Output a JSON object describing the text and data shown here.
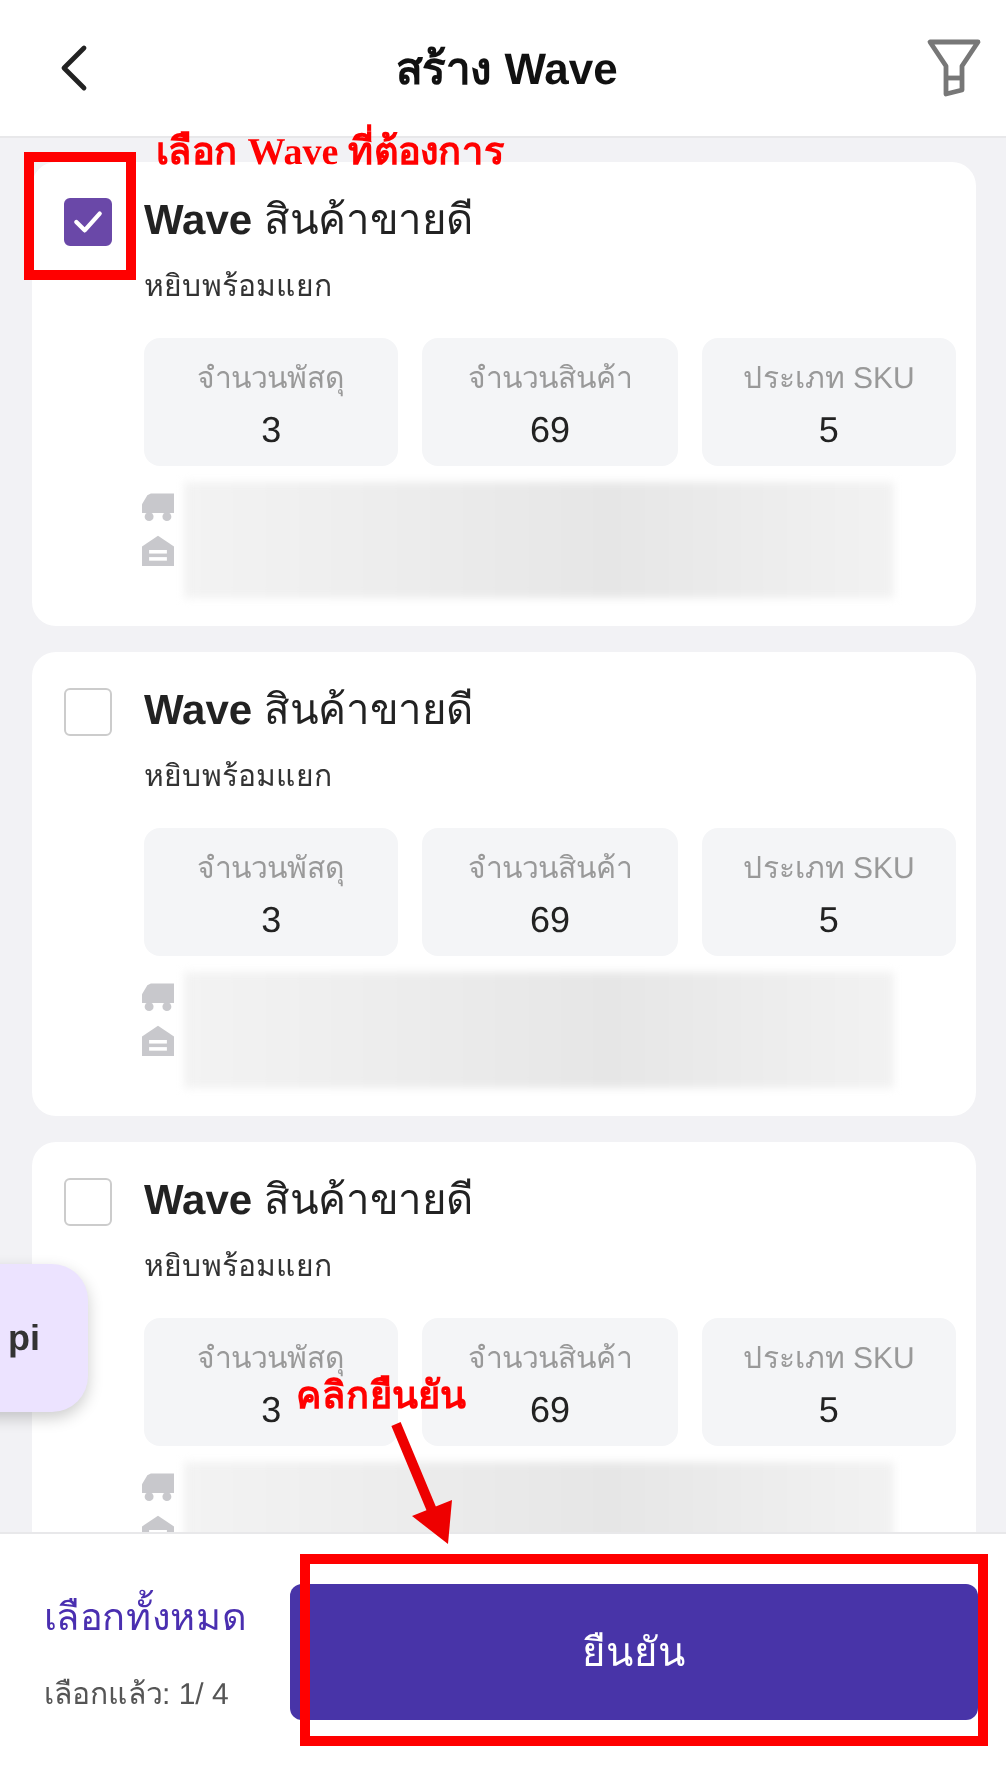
{
  "header": {
    "title": "สร้าง Wave"
  },
  "waves": [
    {
      "title": "**Wave** สินค้าขายดี",
      "subtitle": "หยิบพร้อมแยก",
      "selected": true,
      "stats": [
        {
          "label": "จำนวนพัสดุ",
          "value": "3"
        },
        {
          "label": "จำนวนสินค้า",
          "value": "69"
        },
        {
          "label": "ประเภท SKU",
          "value": "5"
        }
      ]
    },
    {
      "title": "**Wave** สินค้าขายดี",
      "subtitle": "หยิบพร้อมแยก",
      "selected": false,
      "stats": [
        {
          "label": "จำนวนพัสดุ",
          "value": "3"
        },
        {
          "label": "จำนวนสินค้า",
          "value": "69"
        },
        {
          "label": "ประเภท SKU",
          "value": "5"
        }
      ]
    },
    {
      "title": "**Wave** สินค้าขายดี",
      "subtitle": "หยิบพร้อมแยก",
      "selected": false,
      "stats": [
        {
          "label": "จำนวนพัสดุ",
          "value": "3"
        },
        {
          "label": "จำนวนสินค้า",
          "value": "69"
        },
        {
          "label": "ประเภท SKU",
          "value": "5"
        }
      ]
    }
  ],
  "floating_tab": {
    "label": "pi"
  },
  "footer": {
    "select_all": "เลือกทั้งหมด",
    "selected_count": "เลือกแล้ว: 1/ 4",
    "confirm": "ยืนยัน"
  },
  "annotations": [
    {
      "text": "เลือก **Wave** ที่ต้องการ"
    },
    {
      "text": "คลิกยืนยัน"
    }
  ]
}
